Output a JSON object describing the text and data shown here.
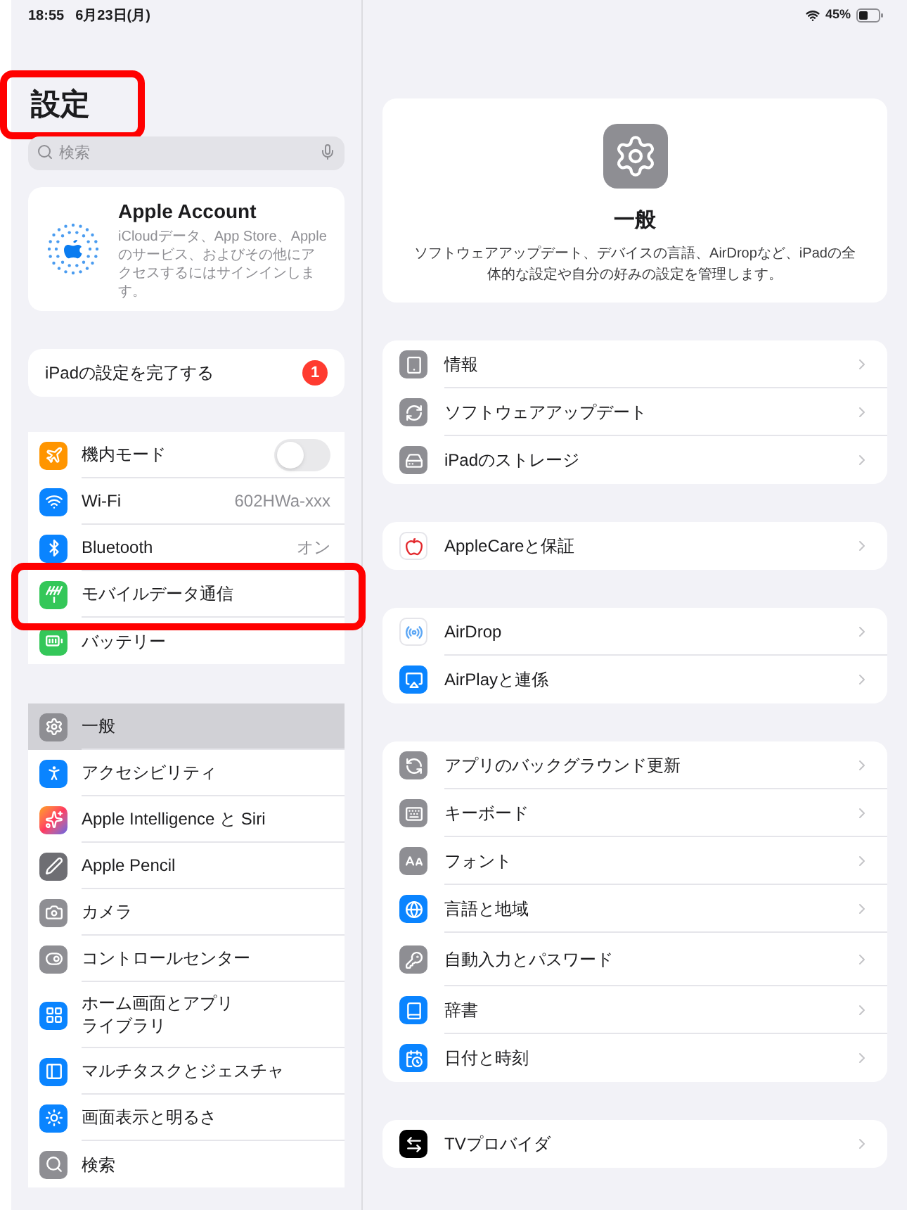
{
  "status_bar": {
    "time": "18:55",
    "date": "6月23日(月)",
    "battery": "45%"
  },
  "sidebar": {
    "title": "設定",
    "title_highlighted": true,
    "search": {
      "placeholder": "検索"
    },
    "account": {
      "name": "Apple Account",
      "description": "iCloudデータ、App Store、Appleのサービス、およびその他にアクセスするにはサインインします。"
    },
    "setup": {
      "label": "iPadの設定を完了する",
      "badge": "1"
    },
    "groups": [
      {
        "items": [
          {
            "kind": "toggle",
            "label": "機内モード",
            "on": false,
            "selected": false,
            "highlighted": false
          },
          {
            "kind": "value",
            "label": "Wi-Fi",
            "value": "602HWa-xxx",
            "selected": false,
            "highlighted": false
          },
          {
            "kind": "value",
            "label": "Bluetooth",
            "value": "オン",
            "selected": false,
            "highlighted": false
          },
          {
            "kind": "plain",
            "label": "モバイルデータ通信",
            "selected": false,
            "highlighted": true
          },
          {
            "kind": "plain",
            "label": "バッテリー",
            "selected": false,
            "highlighted": false
          }
        ]
      },
      {
        "items": [
          {
            "kind": "plain",
            "label": "一般",
            "selected": true,
            "highlighted": false
          },
          {
            "kind": "plain",
            "label": "アクセシビリティ",
            "selected": false,
            "highlighted": false
          },
          {
            "kind": "plain",
            "label": "Apple Intelligence と Siri",
            "selected": false,
            "highlighted": false
          },
          {
            "kind": "plain",
            "label": "Apple Pencil",
            "selected": false,
            "highlighted": false
          },
          {
            "kind": "plain",
            "label": "カメラ",
            "selected": false,
            "highlighted": false
          },
          {
            "kind": "plain",
            "label": "コントロールセンター",
            "selected": false,
            "highlighted": false
          },
          {
            "kind": "plain",
            "label": "ホーム画面とアプリライブラリ",
            "selected": false,
            "highlighted": false
          },
          {
            "kind": "plain",
            "label": "マルチタスクとジェスチャ",
            "selected": false,
            "highlighted": false
          },
          {
            "kind": "plain",
            "label": "画面表示と明るさ",
            "selected": false,
            "highlighted": false
          },
          {
            "kind": "plain",
            "label": "検索",
            "selected": false,
            "highlighted": false
          }
        ]
      }
    ]
  },
  "detail": {
    "header": {
      "title": "一般",
      "description": "ソフトウェアアップデート、デバイスの言語、AirDropなど、iPadの全体的な設定や自分の好みの設定を管理します。"
    },
    "groups": [
      {
        "items": [
          {
            "label": "情報"
          },
          {
            "label": "ソフトウェアアップデート"
          },
          {
            "label": "iPadのストレージ"
          }
        ]
      },
      {
        "items": [
          {
            "label": "AppleCareと保証"
          }
        ]
      },
      {
        "items": [
          {
            "label": "AirDrop"
          },
          {
            "label": "AirPlayと連係"
          }
        ]
      },
      {
        "items": [
          {
            "label": "アプリのバックグラウンド更新"
          },
          {
            "label": "キーボード"
          },
          {
            "label": "フォント"
          },
          {
            "label": "言語と地域"
          },
          {
            "label": "自動入力とパスワード"
          },
          {
            "label": "辞書"
          },
          {
            "label": "日付と時刻"
          }
        ]
      },
      {
        "items": [
          {
            "label": "TVプロバイダ"
          }
        ]
      }
    ]
  }
}
